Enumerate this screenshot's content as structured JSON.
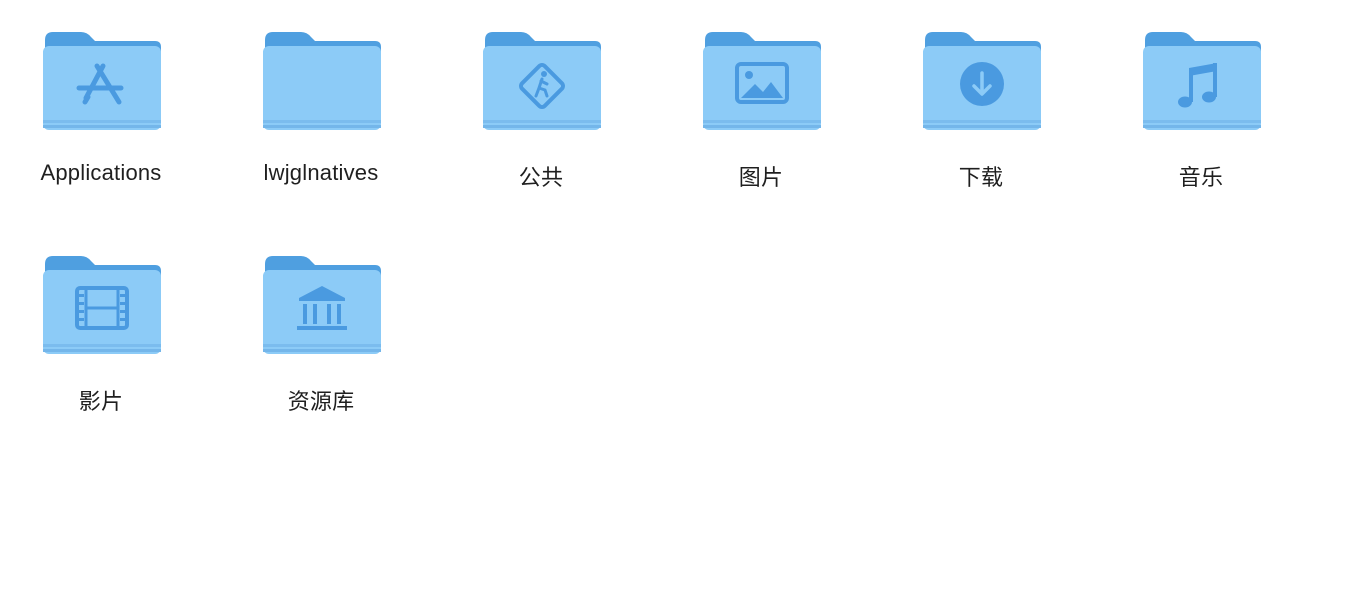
{
  "colors": {
    "folder_back": "#4f9fe0",
    "folder_front": "#8ccbf7",
    "folder_edge": "#74b6ea",
    "glyph": "#4a9ae0"
  },
  "items": [
    {
      "label": "Applications",
      "glyph": "app-store-icon"
    },
    {
      "label": "lwjglnatives",
      "glyph": "none"
    },
    {
      "label": "公共",
      "glyph": "pedestrian-sign-icon"
    },
    {
      "label": "图片",
      "glyph": "picture-icon"
    },
    {
      "label": "下载",
      "glyph": "download-icon"
    },
    {
      "label": "音乐",
      "glyph": "music-note-icon"
    },
    {
      "label": "影片",
      "glyph": "film-icon"
    },
    {
      "label": "资源库",
      "glyph": "library-icon"
    }
  ]
}
